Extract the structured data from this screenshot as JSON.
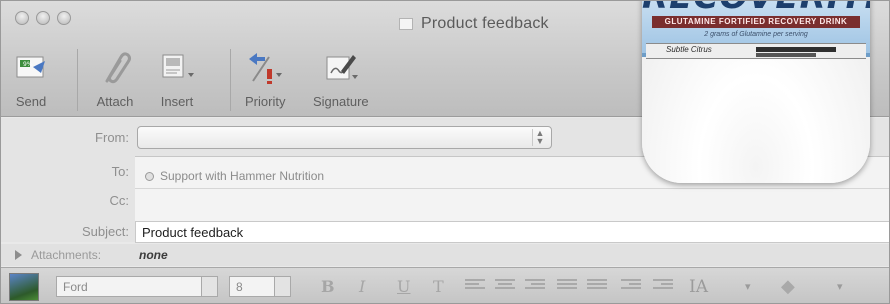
{
  "window": {
    "title": "Product feedback"
  },
  "toolbar": {
    "buttons": [
      {
        "label": "Send",
        "icon": "send-icon"
      },
      {
        "label": "Attach",
        "icon": "paperclip-icon"
      },
      {
        "label": "Insert",
        "icon": "insert-icon"
      },
      {
        "label": "Priority",
        "icon": "priority-icon"
      },
      {
        "label": "Signature",
        "icon": "signature-icon"
      }
    ]
  },
  "fields": {
    "from_label": "From:",
    "from_value": "",
    "to_label": "To:",
    "to_value": "Support with Hammer Nutrition",
    "cc_label": "Cc:",
    "subject_label": "Subject:",
    "subject_value": "Product feedback",
    "attachments_label": "Attachments:",
    "attachments_value": "none"
  },
  "format_bar": {
    "font": "Ford",
    "size": "8",
    "bold": "B",
    "italic": "I",
    "underline": "U",
    "text_style": "T",
    "text_size_icon": "IA"
  },
  "overlay": {
    "brand": "RECOVERITE",
    "tagline": "GLUTAMINE FORTIFIED RECOVERY DRINK",
    "subtag": "2 grams of Glutamine per serving",
    "flavor": "Subtle Citrus"
  },
  "colors": {
    "desktop_bg": "#6f9fc6",
    "window_bg": "#e9e9e9",
    "priority_red": "#c0392b"
  }
}
